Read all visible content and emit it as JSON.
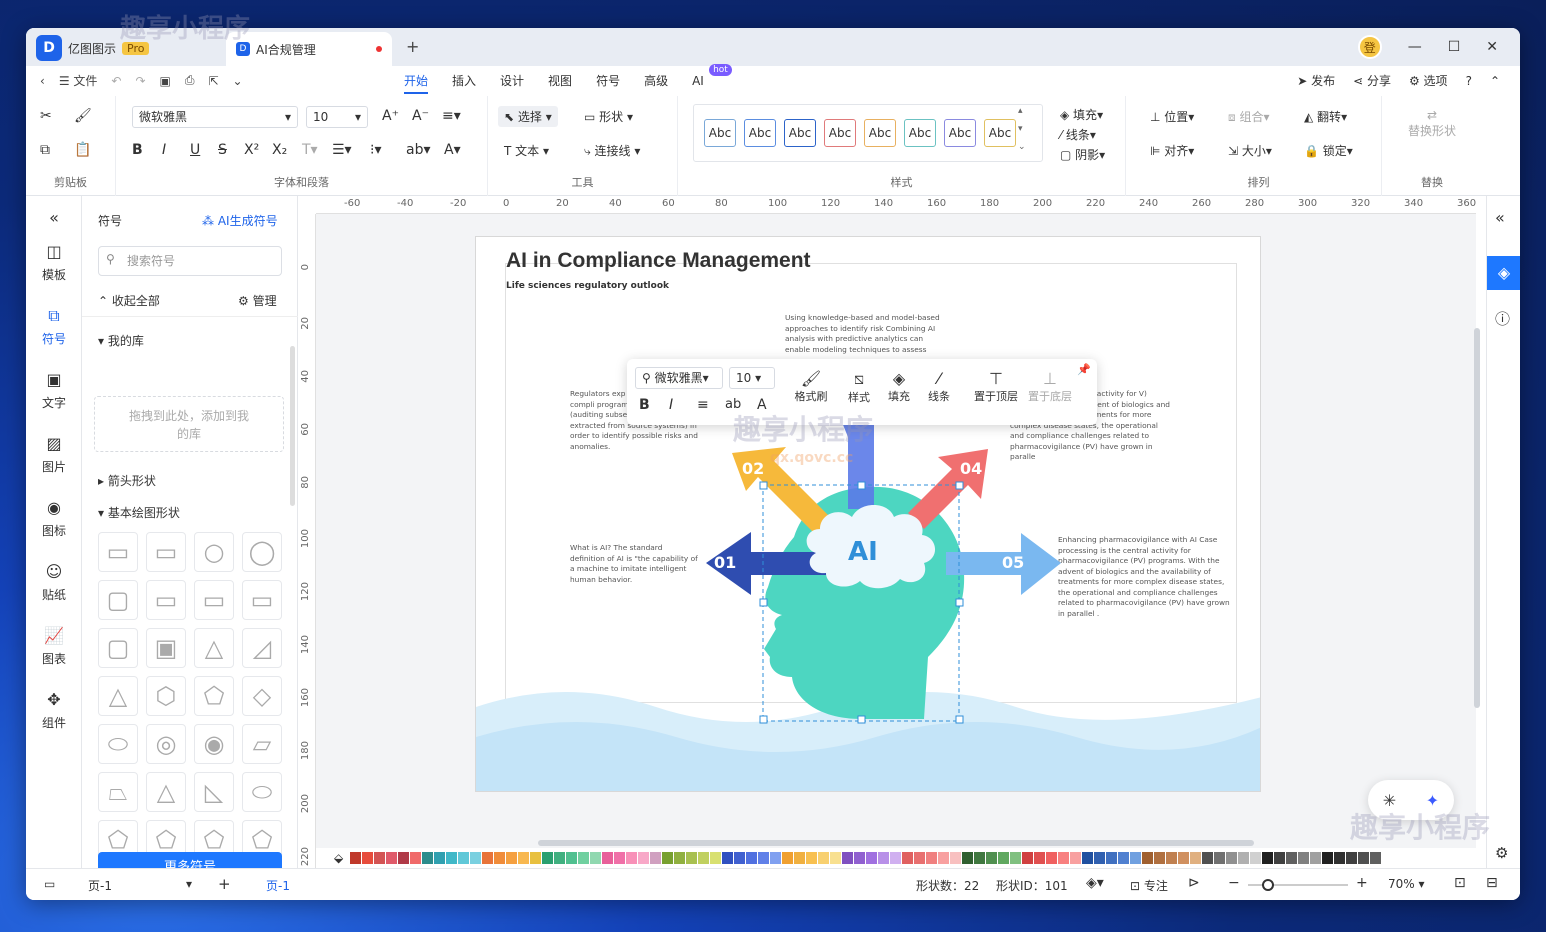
{
  "app": {
    "name": "亿图图示",
    "badge": "Pro",
    "doc_tab": "AI合规管理",
    "login": "登"
  },
  "menu": {
    "file": "文件",
    "tabs": [
      "开始",
      "插入",
      "设计",
      "视图",
      "符号",
      "高级",
      "AI"
    ],
    "hot": "hot",
    "publish": "发布",
    "share": "分享",
    "options": "选项"
  },
  "ribbon": {
    "clipboard": "剪贴板",
    "font_para": "字体和段落",
    "tools": "工具",
    "style": "样式",
    "arrange": "排列",
    "replace": "替换",
    "font": "微软雅黑",
    "size": "10",
    "select": "选择",
    "shape": "形状",
    "text": "文本",
    "connector": "连接线",
    "fill": "填充",
    "line": "线条",
    "shadow": "阴影",
    "position": "位置",
    "group": "组合",
    "flip": "翻转",
    "align": "对齐",
    "sizebtn": "大小",
    "lock": "锁定",
    "replace_shape": "替换形状",
    "abc": [
      "Abc",
      "Abc",
      "Abc",
      "Abc",
      "Abc",
      "Abc",
      "Abc",
      "Abc"
    ],
    "abc_colors": [
      "#7aa8d8",
      "#5b8de0",
      "#2c63c9",
      "#e07a7a",
      "#e8b060",
      "#6bc2c2",
      "#8a8ae0",
      "#e0c060"
    ]
  },
  "leftbar": [
    "模板",
    "符号",
    "文字",
    "图片",
    "图标",
    "贴纸",
    "图表",
    "组件"
  ],
  "panel": {
    "title": "符号",
    "ai_gen": "AI生成符号",
    "search": "搜索符号",
    "collapse": "收起全部",
    "manage": "管理",
    "mylib": "我的库",
    "drop": "拖拽到此处，添加到我的库",
    "arrows": "箭头形状",
    "basic": "基本绘图形状",
    "more": "更多符号"
  },
  "ruler_h": [
    "-60",
    "-40",
    "-20",
    "0",
    "20",
    "40",
    "60",
    "80",
    "100",
    "120",
    "140",
    "160",
    "180",
    "200",
    "220",
    "240",
    "260",
    "280",
    "300",
    "320",
    "340",
    "360"
  ],
  "ruler_v": [
    "0",
    "20",
    "40",
    "60",
    "80",
    "100",
    "120",
    "140",
    "160",
    "180",
    "200",
    "220"
  ],
  "page": {
    "title": "AI in Compliance Management",
    "subtitle": "Life sciences regulatory outlook",
    "t_top": "Using knowledge-based and model-based approaches to identify risk Combining AI analysis with predictive analytics can enable modeling techniques to assess",
    "t_left1": "Regulators exp monitoring Tra driven compli programs have sampling (auditing subsets of transaction data extracted from source systems) in order to identify possible risks and anomalies.",
    "t_right1": "igilance with AI central activity for V) programs. With the advent of biologics and the availability of treatments for more complex disease states, the operational and compliance challenges related to pharmacovigilance (PV) have grown in paralle",
    "t_left2": "What is AI? The standard definition of AI is \"the capability of a machine to imitate intelligent human behavior.",
    "t_right2": "Enhancing pharmacovigilance with AI Case processing is the central activity for pharmacovigilance (PV) programs. With the advent of biologics and the availability of treatments for more complex disease states, the operational and compliance challenges related to pharmacovigilance (PV) have grown in parallel .",
    "ai": "AI",
    "n1": "01",
    "n2": "02",
    "n4": "04",
    "n5": "05"
  },
  "floatbar": {
    "font": "微软雅黑",
    "size": "10",
    "brush": "格式刷",
    "style": "样式",
    "fill": "填充",
    "line": "线条",
    "front": "置于顶层",
    "back": "置于底层"
  },
  "status": {
    "page_sel": "页-1",
    "page_tab": "页-1",
    "shapes": "形状数：22",
    "shape_id": "形状ID：101",
    "focus": "专注",
    "zoom": "70%"
  },
  "watermark": {
    "text": "趣享小程序",
    "sub": "qx.qovc.cc"
  },
  "palette": [
    "#c0392b",
    "#e74c3c",
    "#d35454",
    "#e05a6a",
    "#b03a48",
    "#f06a6a",
    "#2c8c8c",
    "#30a0b0",
    "#40b8c8",
    "#60c8d8",
    "#7ad0e0",
    "#e8743a",
    "#f08c3a",
    "#f5a040",
    "#f8b850",
    "#e8c040",
    "#2aa070",
    "#40b080",
    "#50c090",
    "#70d0a0",
    "#90d8b0",
    "#e8609a",
    "#f070a8",
    "#f890b8",
    "#f8a8c8",
    "#d0a0c0",
    "#78a030",
    "#90b040",
    "#a8c050",
    "#c0d060",
    "#d8e070",
    "#3050c0",
    "#4060d0",
    "#5070e0",
    "#6080e8",
    "#80a0f0",
    "#f0a030",
    "#f0b040",
    "#f8c050",
    "#f8d070",
    "#f8e090",
    "#8050c0",
    "#9060d0",
    "#a070e0",
    "#b890e8",
    "#d0b0f0",
    "#e06060",
    "#e87070",
    "#f08080",
    "#f8a0a0",
    "#f8c0c0",
    "#306030",
    "#407840",
    "#509050",
    "#60a860",
    "#80c080",
    "#d04040",
    "#e05050",
    "#f06060",
    "#f88080",
    "#f8a0a0",
    "#2050a0",
    "#3060b0",
    "#4070c0",
    "#5080d0",
    "#70a0e0",
    "#a06030",
    "#b07040",
    "#c08050",
    "#d09060",
    "#e0b080",
    "#505050",
    "#707070",
    "#909090",
    "#b0b0b0",
    "#d0d0d0",
    "#202020",
    "#404040",
    "#606060",
    "#808080",
    "#a0a0a0",
    "#202020",
    "#303030",
    "#404040",
    "#505050",
    "#606060"
  ]
}
